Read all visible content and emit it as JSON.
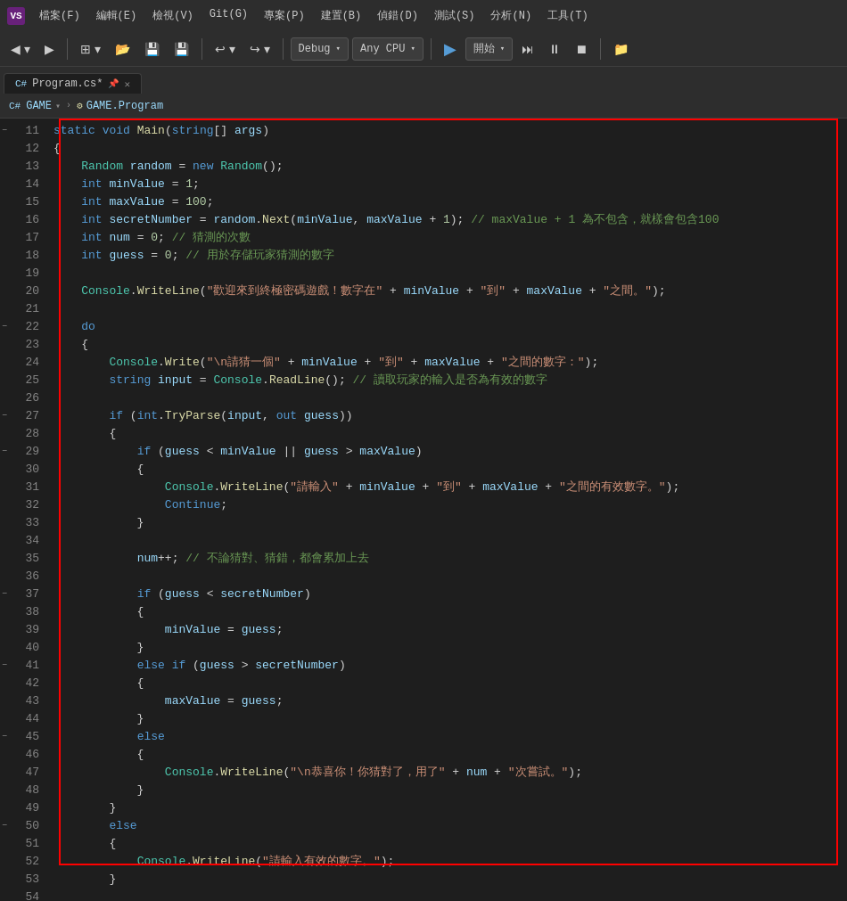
{
  "titlebar": {
    "app_icon": "VS",
    "menus": [
      "檔案(F)",
      "編輯(E)",
      "檢視(V)",
      "Git(G)",
      "專案(P)",
      "建置(B)",
      "偵錯(D)",
      "測試(S)",
      "分析(N)",
      "工具(T)"
    ]
  },
  "toolbar": {
    "debug_label": "Debug",
    "cpu_label": "Any CPU",
    "start_label": "開始"
  },
  "tab": {
    "filename": "Program.cs*",
    "pin": "📌"
  },
  "breadcrumb": {
    "namespace": "GAME",
    "class": "GAME.Program"
  }
}
